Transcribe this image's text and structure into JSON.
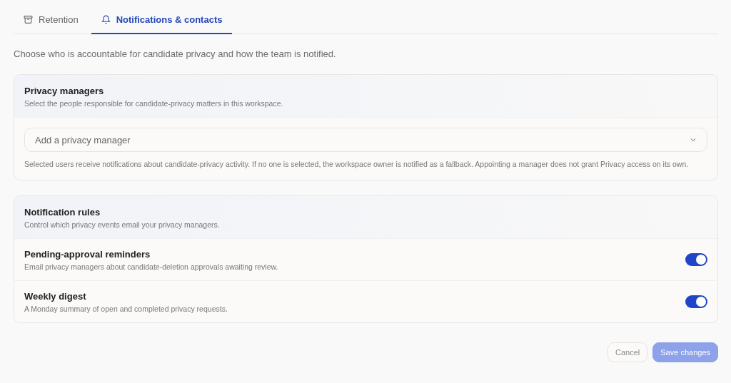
{
  "tabs": [
    {
      "label": "Retention",
      "kind": "archive",
      "selected": false
    },
    {
      "label": "Notifications & contacts",
      "kind": "bell",
      "selected": true
    }
  ],
  "intro": "Choose who is accountable for candidate privacy and how the team is notified.",
  "privacy_managers": {
    "title": "Privacy managers",
    "subtitle": "Select the people responsible for candidate-privacy matters in this workspace.",
    "select": {
      "placeholder": "Add a privacy manager"
    },
    "help": "Selected users receive notifications about candidate-privacy activity. If no one is selected, the workspace owner is notified as a fallback. Appointing a manager does not grant Privacy access on its own."
  },
  "notification_rules": {
    "title": "Notification rules",
    "subtitle": "Control which privacy events email your privacy managers.",
    "rules": [
      {
        "label": "Pending-approval reminders",
        "description": "Email privacy managers about candidate-deletion approvals awaiting review.",
        "on": true
      },
      {
        "label": "Weekly digest",
        "description": "A Monday summary of open and completed privacy requests.",
        "on": true
      }
    ]
  },
  "buttons": [
    {
      "label": "Cancel",
      "kind": "secondary",
      "disabled": false
    },
    {
      "label": "Save changes",
      "kind": "primary",
      "disabled": true
    }
  ]
}
